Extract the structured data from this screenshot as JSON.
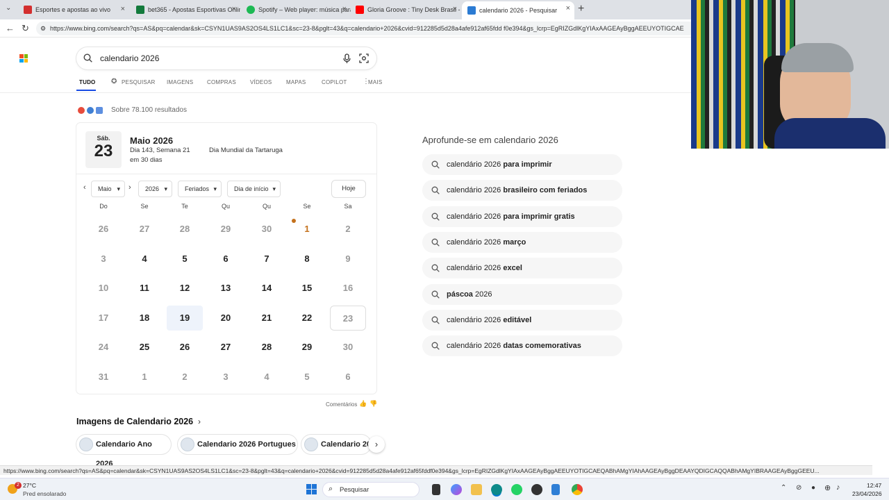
{
  "browser": {
    "tabs": [
      {
        "title": "Esportes e apostas ao vivo",
        "color": "#d32f2f"
      },
      {
        "title": "bet365 - Apostas Esportivas Onlin",
        "color": "#137a3c"
      },
      {
        "title": "Spotify – Web player: música para",
        "color": "#1db954"
      },
      {
        "title": "Gloria Groove : Tiny Desk Brasil - Y",
        "color": "#ff0000"
      },
      {
        "title": "calendario 2026 - Pesquisar",
        "color": "#2b7bd3"
      }
    ],
    "url": "https://www.bing.com/search?qs=AS&pq=calendar&sk=CSYN1UAS9AS2OS4LS1LC1&sc=23-8&pglt=43&q=calendario+2026&cvid=912285d5d28a4afe912af65fdd f0e394&gs_lcrp=EgRIZGdlKgYIAxAAGEAyBggAEEUYOTIGCAE"
  },
  "search": {
    "query": "calendario 2026"
  },
  "nav": [
    "TUDO",
    "PESQUISAR",
    "IMAGENS",
    "COMPRAS",
    "VÍDEOS",
    "MAPAS",
    "COPILOT",
    "MAIS"
  ],
  "results_count": "Sobre 78.100 resultados",
  "calendar": {
    "weekday_short": "Sáb.",
    "day": "23",
    "month_title": "Maio 2026",
    "day_info": "Dia 143, Semana 21",
    "in_days": "em 30 dias",
    "event": "Dia Mundial da Tartaruga",
    "month_select": "Maio",
    "year_select": "2026",
    "holidays_select": "Feriados",
    "start_select": "Dia de início",
    "today_button": "Hoje",
    "weekdays": [
      "Do",
      "Se",
      "Te",
      "Qu",
      "Qu",
      "Se",
      "Sa"
    ],
    "weeks": [
      [
        "26",
        "27",
        "28",
        "29",
        "30",
        "1",
        "2"
      ],
      [
        "3",
        "4",
        "5",
        "6",
        "7",
        "8",
        "9"
      ],
      [
        "10",
        "11",
        "12",
        "13",
        "14",
        "15",
        "16"
      ],
      [
        "17",
        "18",
        "19",
        "20",
        "21",
        "22",
        "23"
      ],
      [
        "24",
        "25",
        "26",
        "27",
        "28",
        "29",
        "30"
      ],
      [
        "31",
        "1",
        "2",
        "3",
        "4",
        "5",
        "6"
      ]
    ],
    "feedback": "Comentários"
  },
  "related": {
    "title": "Aprofunde-se em calendario 2026",
    "items": [
      {
        "plain": "calendário 2026 ",
        "bold": "para imprimir"
      },
      {
        "plain": "calendário 2026 ",
        "bold": "brasileiro com feriados"
      },
      {
        "plain": "calendário 2026 ",
        "bold": "para imprimir gratis"
      },
      {
        "plain": "calendário 2026 ",
        "bold": "março"
      },
      {
        "plain": "calendário 2026 ",
        "bold": "excel"
      },
      {
        "plain": " 2026",
        "bold": "páscoa"
      },
      {
        "plain": "calendário 2026 ",
        "bold": "editável"
      },
      {
        "plain": "calendário 2026 ",
        "bold": "datas comemorativas"
      }
    ]
  },
  "images": {
    "title": "Imagens de Calendario 2026",
    "chips": [
      "Calendario Ano 2026",
      "Calendario 2026 Portugues",
      "Calendario 20"
    ]
  },
  "status_url": "https://www.bing.com/search?qs=AS&pq=calendar&sk=CSYN1UAS9AS2OS4LS1LC1&sc=23-8&pglt=43&q=calendario+2026&cvid=912285d5d28a4afe912af65fddf0e394&gs_lcrp=EgRIZGdlKgYIAxAAGEAyBggAEEUYOTIGCAEQABhAMgYIAhAAGEAyBggDEAAYQDIGCAQQABhAMgYIBRAAGEAyBggGEEU...",
  "taskbar": {
    "badge": "2",
    "temp": "27°C",
    "weather": "Pred ensolarado",
    "search": "Pesquisar",
    "time": "12:47",
    "date": "23/04/2026"
  }
}
